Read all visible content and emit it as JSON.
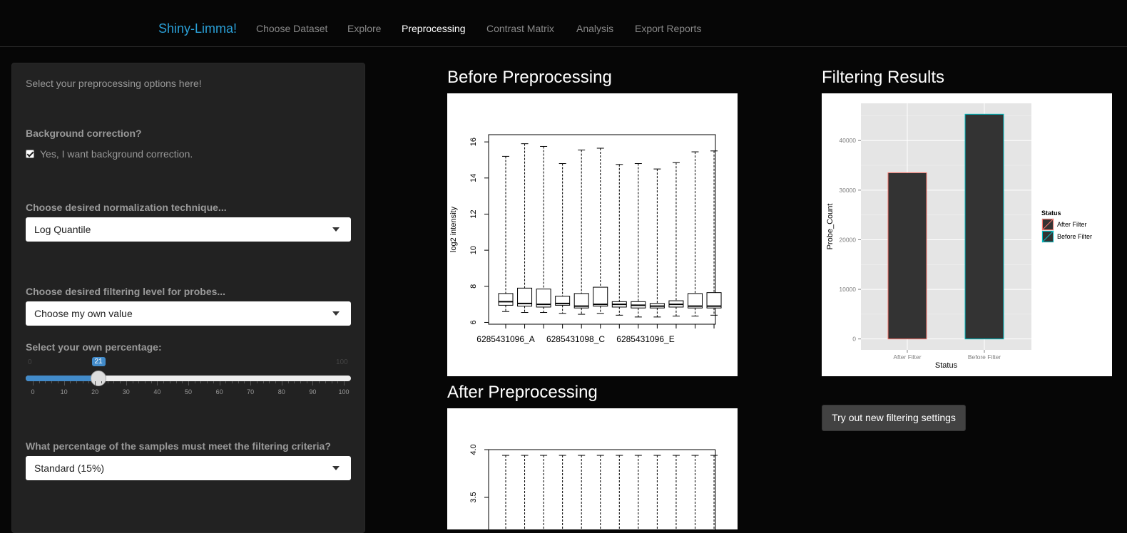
{
  "navbar": {
    "brand": "Shiny-Limma!",
    "items": [
      "Choose Dataset",
      "Explore",
      "Preprocessing",
      "Contrast Matrix",
      "Analysis",
      "Export Reports"
    ],
    "active": "Preprocessing"
  },
  "sidebar": {
    "intro": "Select your preprocessing options here!",
    "background_label": "Background correction?",
    "background_checkbox": "Yes, I want background correction.",
    "background_checked": true,
    "normalization_label": "Choose desired normalization technique...",
    "normalization_value": "Log Quantile",
    "filtering_label": "Choose desired filtering level for probes...",
    "filtering_value": "Choose my own value",
    "percentage_label": "Select your own percentage:",
    "slider": {
      "min": 0,
      "max": 100,
      "value": 21,
      "min_label": "0",
      "max_label": "100",
      "value_label": "21",
      "ticks": [
        "0",
        "10",
        "20",
        "30",
        "40",
        "50",
        "60",
        "70",
        "80",
        "90",
        "100"
      ]
    },
    "samples_label": "What percentage of the samples must meet the filtering criteria?",
    "samples_value": "Standard (15%)"
  },
  "before": {
    "title": "Before Preprocessing",
    "chart_data": {
      "type": "boxplot",
      "ylabel": "log2 intensity",
      "ylim": [
        5.9,
        16.4
      ],
      "yticks": [
        "6",
        "8",
        "10",
        "12",
        "14",
        "16"
      ],
      "xlabels": [
        "6285431096_A",
        "6285431098_C",
        "6285431096_E"
      ],
      "boxes": [
        {
          "min": 6.6,
          "q1": 6.95,
          "median": 7.15,
          "q3": 7.6,
          "max": 15.2
        },
        {
          "min": 6.55,
          "q1": 6.9,
          "median": 7.05,
          "q3": 7.9,
          "max": 15.9
        },
        {
          "min": 6.55,
          "q1": 6.85,
          "median": 7.0,
          "q3": 7.85,
          "max": 15.75
        },
        {
          "min": 6.5,
          "q1": 6.95,
          "median": 7.05,
          "q3": 7.45,
          "max": 14.8
        },
        {
          "min": 6.45,
          "q1": 6.8,
          "median": 6.9,
          "q3": 7.6,
          "max": 15.55
        },
        {
          "min": 6.5,
          "q1": 6.9,
          "median": 7.0,
          "q3": 7.95,
          "max": 15.65
        },
        {
          "min": 6.4,
          "q1": 6.85,
          "median": 7.0,
          "q3": 7.15,
          "max": 14.75
        },
        {
          "min": 6.3,
          "q1": 6.8,
          "median": 6.95,
          "q3": 7.15,
          "max": 14.8
        },
        {
          "min": 6.3,
          "q1": 6.8,
          "median": 6.9,
          "q3": 7.05,
          "max": 14.5
        },
        {
          "min": 6.35,
          "q1": 6.85,
          "median": 7.0,
          "q3": 7.2,
          "max": 14.85
        },
        {
          "min": 6.35,
          "q1": 6.8,
          "median": 6.9,
          "q3": 7.6,
          "max": 15.45
        },
        {
          "min": 6.4,
          "q1": 6.8,
          "median": 6.9,
          "q3": 7.65,
          "max": 15.5
        }
      ]
    }
  },
  "after": {
    "title": "After Preprocessing",
    "chart_data": {
      "type": "boxplot",
      "ylim": [
        2.9,
        4.0
      ],
      "yticks": [
        "3.5",
        "4.0"
      ],
      "whisker_top": 3.94,
      "count": 12
    }
  },
  "filtering": {
    "title": "Filtering Results",
    "chart_data": {
      "type": "bar",
      "categories": [
        "After Filter",
        "Before Filter"
      ],
      "values": [
        33500,
        45300
      ],
      "xlabel": "Status",
      "ylabel": "Probe_Count",
      "ylim": [
        -2200,
        47500
      ],
      "yticks": [
        0,
        10000,
        20000,
        30000,
        40000
      ],
      "legend_title": "Status",
      "legend": [
        {
          "name": "After Filter",
          "color": "#f8766d"
        },
        {
          "name": "Before Filter",
          "color": "#00bfc4"
        }
      ],
      "bar_fill": "#333333"
    },
    "button_label": "Try out new filtering settings"
  }
}
